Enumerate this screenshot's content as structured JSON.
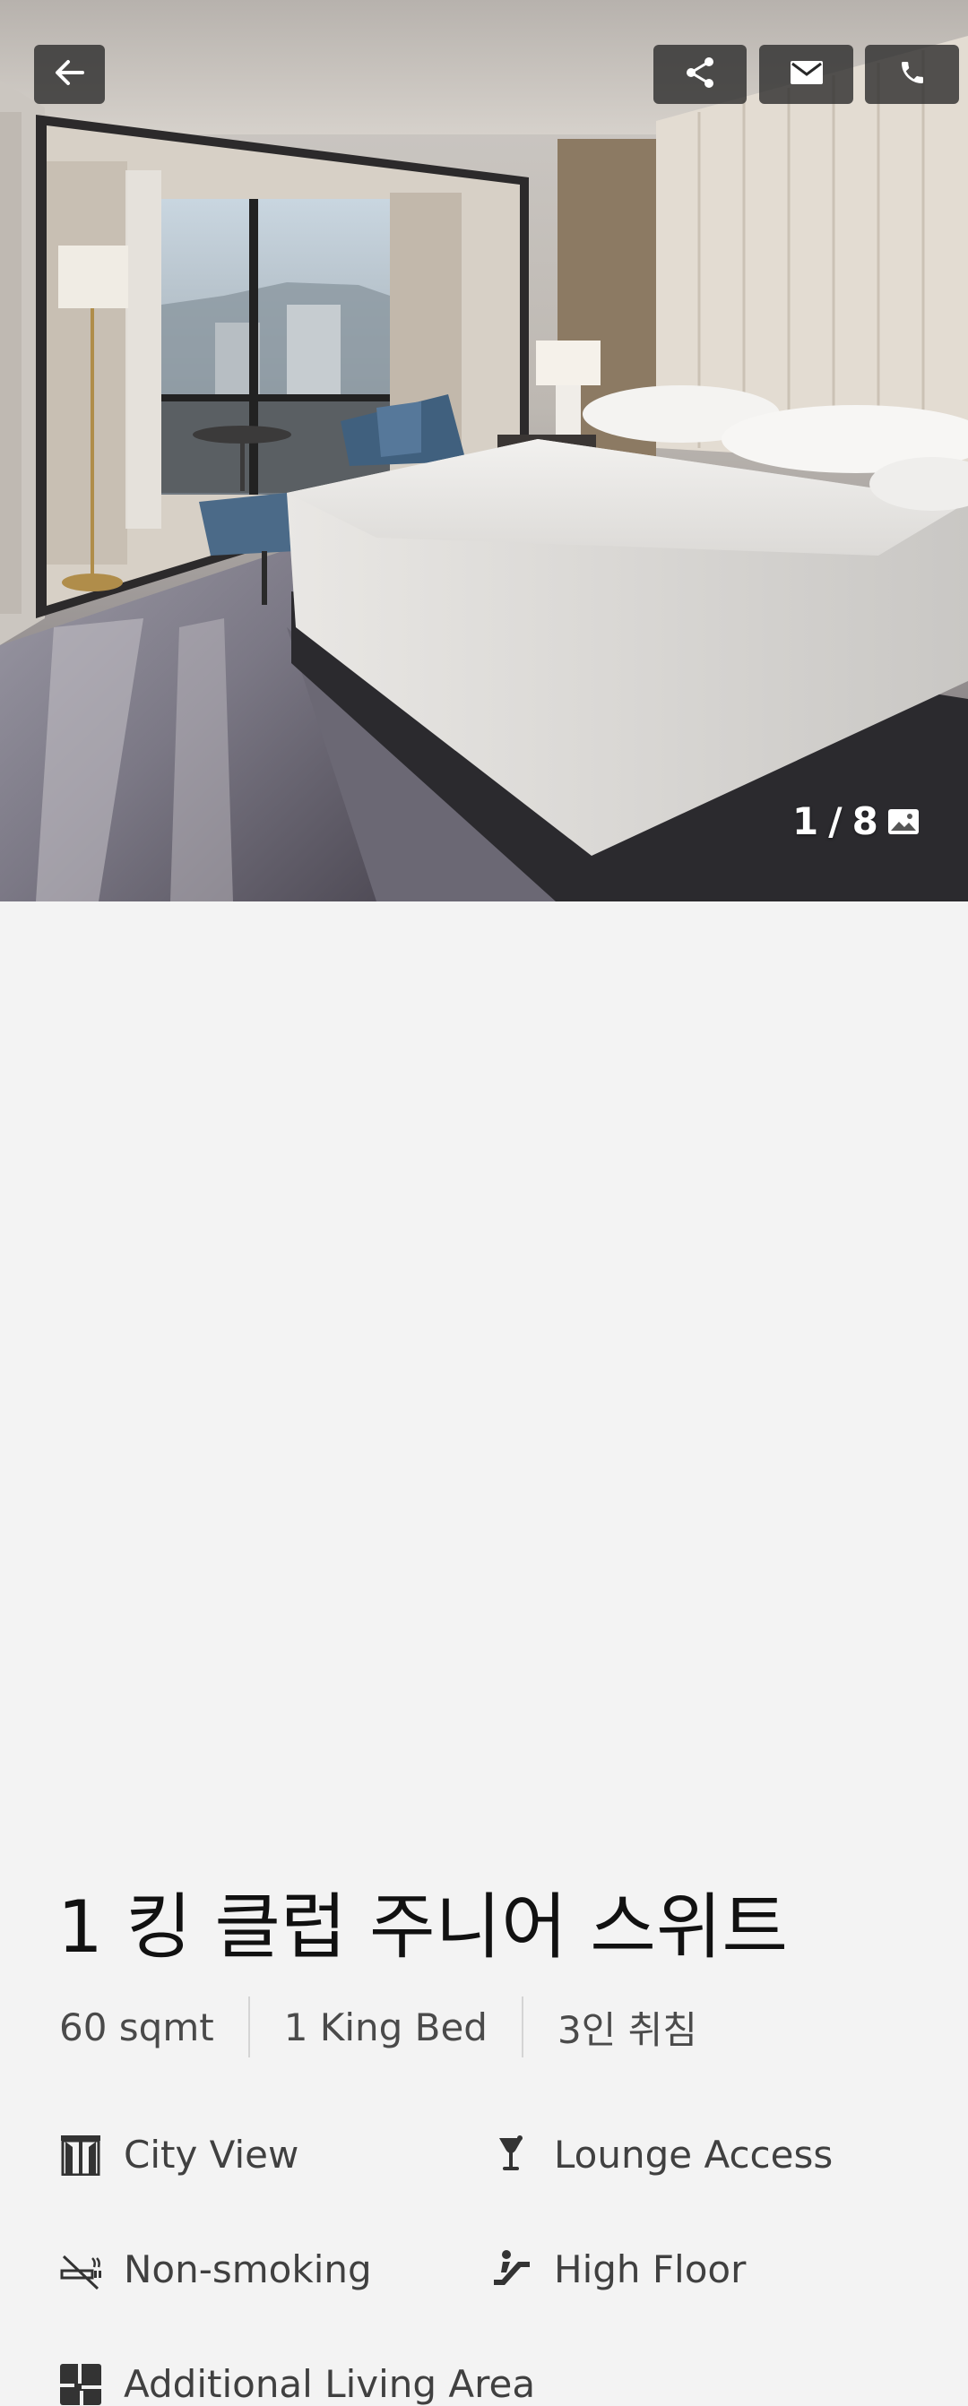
{
  "gallery": {
    "current": "1",
    "separator": "/",
    "total": "8",
    "icon": "image-icon"
  },
  "toolbar": {
    "back_icon": "back-arrow-icon",
    "share_icon": "share-icon",
    "mail_icon": "mail-icon",
    "phone_icon": "phone-icon"
  },
  "room": {
    "title": "1 킹 클럽 주니어 스위트",
    "specs": [
      "60 sqmt",
      "1 King Bed",
      "3인 취침"
    ],
    "features": [
      {
        "label": "City View",
        "icon": "window-icon"
      },
      {
        "label": "Lounge Access",
        "icon": "cocktail-icon"
      },
      {
        "label": "Non-smoking",
        "icon": "no-smoking-icon"
      },
      {
        "label": "High Floor",
        "icon": "escalator-icon"
      },
      {
        "label": "Additional Living Area",
        "icon": "floor-plan-icon"
      }
    ]
  },
  "colors": {
    "background": "#f3f3f3",
    "button_bg": "#282828",
    "title_text": "#111111",
    "body_text": "#404040"
  }
}
